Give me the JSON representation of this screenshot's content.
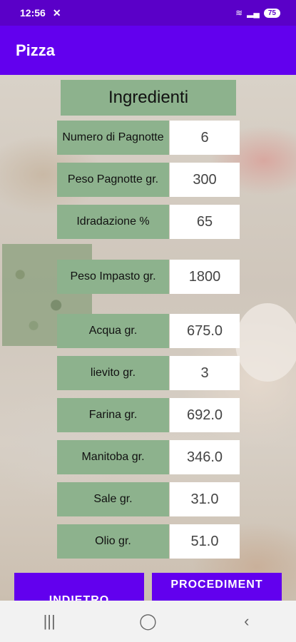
{
  "status_bar": {
    "time": "12:56",
    "battery": "75"
  },
  "app_bar": {
    "title": "Pizza"
  },
  "heading": "Ingredienti",
  "rows": [
    {
      "label": "Numero di Pagnotte",
      "value": "6"
    },
    {
      "label": "Peso Pagnotte gr.",
      "value": "300"
    },
    {
      "label": "Idradazione %",
      "value": "65"
    },
    {
      "label": "Peso Impasto gr.",
      "value": "1800"
    },
    {
      "label": "Acqua gr.",
      "value": "675.0"
    },
    {
      "label": "lievito gr.",
      "value": "3"
    },
    {
      "label": "Farina gr.",
      "value": "692.0"
    },
    {
      "label": "Manitoba gr.",
      "value": "346.0"
    },
    {
      "label": "Sale gr.",
      "value": "31.0"
    },
    {
      "label": "Olio gr.",
      "value": "51.0"
    }
  ],
  "buttons": {
    "back": "INDIETRO",
    "procedure": "PROCEDIMENT"
  },
  "icons": {
    "status_left": "shuffle-icon",
    "nav_recent": "recent-apps-icon",
    "nav_home": "home-icon",
    "nav_back": "back-icon"
  }
}
